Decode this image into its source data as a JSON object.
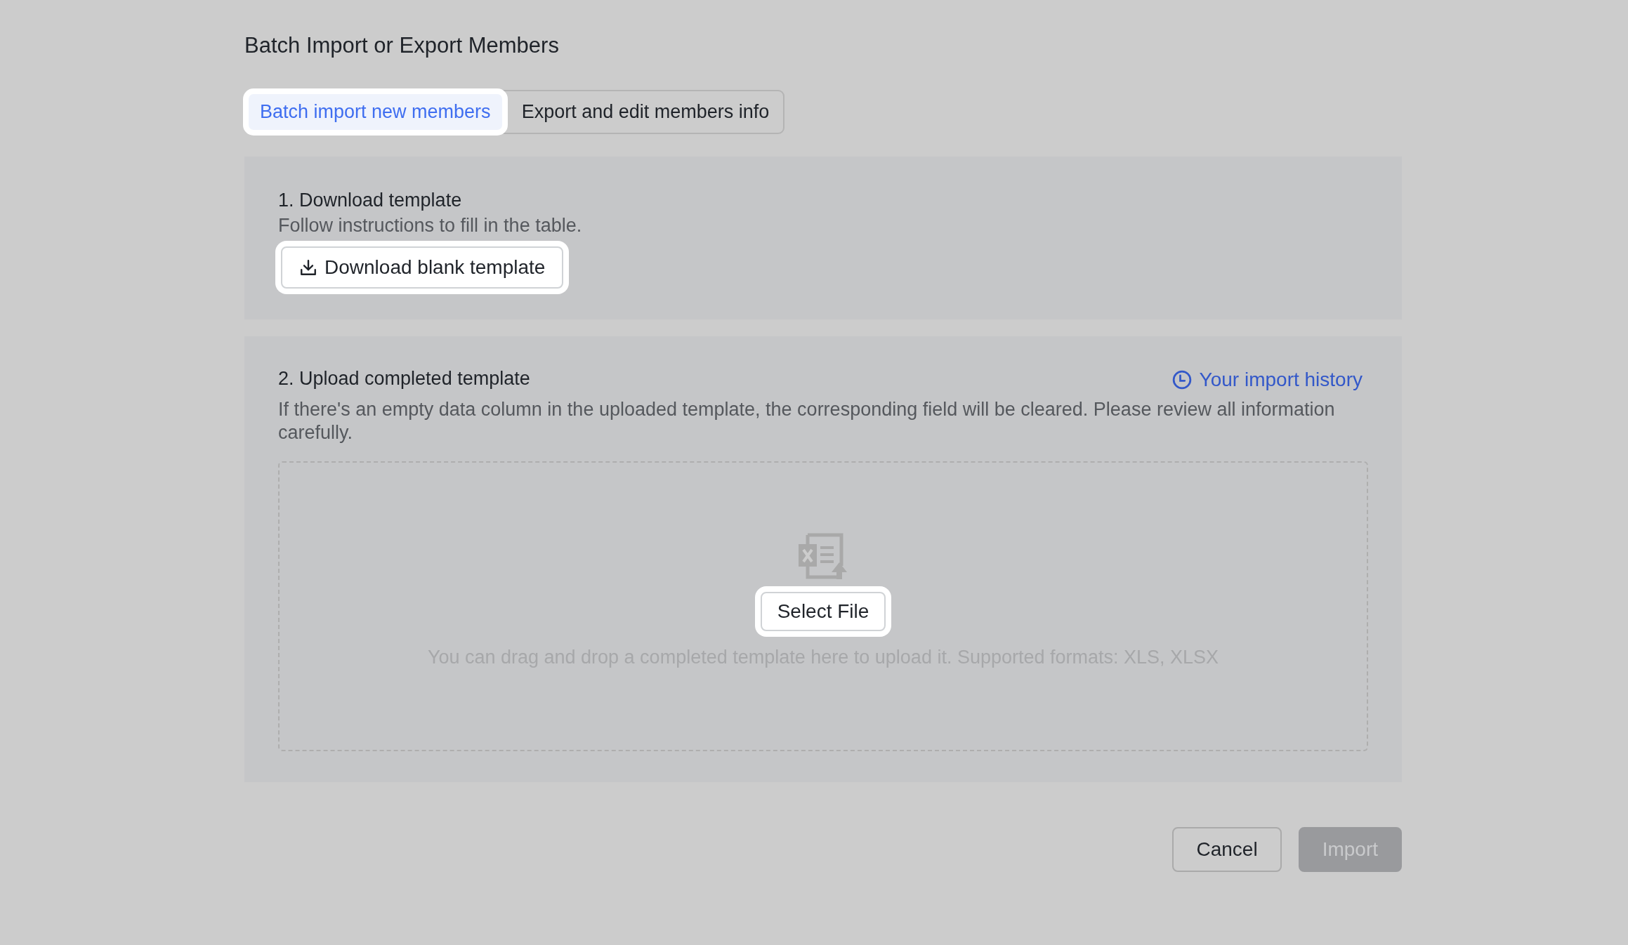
{
  "title": "Batch Import or Export Members",
  "tabs": [
    {
      "label": "Batch import new members",
      "selected": true,
      "highlighted": true
    },
    {
      "label": "Export and edit members info",
      "selected": false,
      "highlighted": false
    }
  ],
  "download_section": {
    "heading": "1. Download template",
    "hint": "Follow instructions to fill in the table.",
    "button": {
      "label": "Download blank template",
      "highlighted": true
    }
  },
  "upload_section": {
    "heading": "2. Upload completed template",
    "history_link": "Your import history",
    "notice": "If there's an empty data column in the uploaded template, the corresponding field will be cleared. Please review all information carefully.",
    "dropzone": {
      "button": {
        "label": "Select File",
        "highlighted": true
      },
      "hint": "You can drag and drop a completed template here to upload it. Supported formats: XLS, XLSX"
    }
  },
  "footer": [
    {
      "label": "Cancel",
      "kind": "secondary",
      "disabled": false
    },
    {
      "label": "Import",
      "kind": "primary",
      "disabled": true
    }
  ]
}
